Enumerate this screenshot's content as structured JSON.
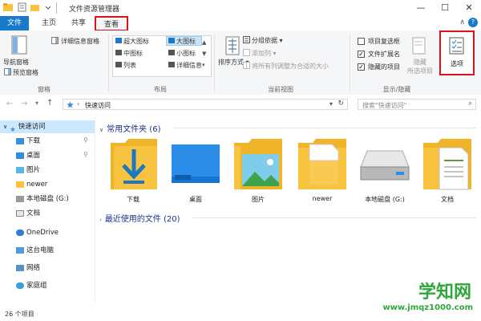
{
  "window": {
    "title": "文件资源管理器",
    "controls": {
      "minimize": "—",
      "maximize": "☐",
      "close": "✕"
    }
  },
  "tabs": [
    {
      "label": "文件"
    },
    {
      "label": "主页"
    },
    {
      "label": "共享"
    },
    {
      "label": "查看"
    }
  ],
  "ribbon": {
    "panes": {
      "nav_pane": "导航窗格",
      "preview_pane": "预览窗格",
      "details_pane": "详细信息窗格",
      "group_label": "窗格"
    },
    "layout": {
      "items": [
        "超大图标",
        "大图标",
        "小图标",
        "中图标",
        "列表",
        "详细信息"
      ],
      "group_label": "布局"
    },
    "current_view": {
      "sort": "排序方式",
      "group_by": "分组依据",
      "add_column": "添加列",
      "fit_columns": "将所有列调整为合适的大小",
      "group_label": "当前视图"
    },
    "show_hide": {
      "item_checkbox": "项目复选框",
      "file_ext": "文件扩展名",
      "hidden_items": "隐藏的项目",
      "hide": "隐藏",
      "hide_selected": "所选项目",
      "group_label": "显示/隐藏"
    },
    "options": "选项"
  },
  "address": {
    "path": "快速访问",
    "search_placeholder": "搜索\"快速访问\""
  },
  "nav": [
    {
      "label": "快速访问"
    },
    {
      "label": "下载"
    },
    {
      "label": "桌面"
    },
    {
      "label": "图片"
    },
    {
      "label": "newer"
    },
    {
      "label": "本地磁盘 (G:)"
    },
    {
      "label": "文档"
    },
    {
      "label": "OneDrive"
    },
    {
      "label": "这台电脑"
    },
    {
      "label": "网络"
    },
    {
      "label": "家庭组"
    }
  ],
  "content": {
    "frequent_header": "常用文件夹 (6)",
    "recent_header": "最近使用的文件 (20)",
    "folders": [
      {
        "label": "下载"
      },
      {
        "label": "桌面"
      },
      {
        "label": "图片"
      },
      {
        "label": "newer"
      },
      {
        "label": "本地磁盘 (G:)"
      },
      {
        "label": "文档"
      }
    ]
  },
  "status": {
    "count": "26 个项目"
  },
  "watermark": {
    "title": "学知网",
    "url": "www.jmqz1000.com"
  },
  "colors": {
    "accent": "#1979ca",
    "highlight": "#e0111a",
    "folder": "#f8c43f",
    "header": "#1e3287"
  }
}
